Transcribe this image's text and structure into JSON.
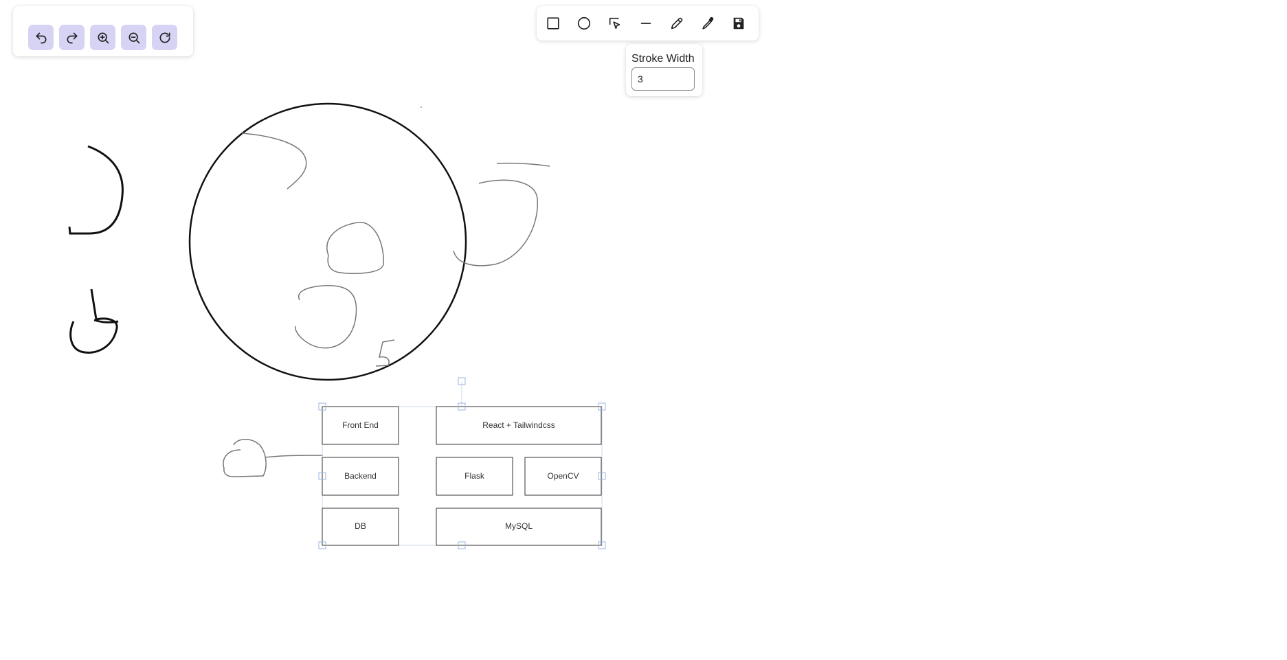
{
  "history_toolbar": {
    "buttons": [
      {
        "id": "undo",
        "icon": "undo-icon"
      },
      {
        "id": "redo",
        "icon": "redo-icon"
      },
      {
        "id": "zoom_in",
        "icon": "zoom-in-icon"
      },
      {
        "id": "zoom_out",
        "icon": "zoom-out-icon"
      },
      {
        "id": "reset",
        "icon": "reset-icon"
      }
    ]
  },
  "tools_toolbar": {
    "tools": [
      {
        "id": "rectangle",
        "icon": "rectangle-icon"
      },
      {
        "id": "circle",
        "icon": "circle-icon"
      },
      {
        "id": "select",
        "icon": "select-cursor-icon"
      },
      {
        "id": "line",
        "icon": "line-icon"
      },
      {
        "id": "pencil",
        "icon": "pencil-icon"
      },
      {
        "id": "eyedropper",
        "icon": "eyedropper-icon"
      },
      {
        "id": "save",
        "icon": "save-icon"
      }
    ]
  },
  "stroke_panel": {
    "label": "Stroke Width",
    "value": "3"
  },
  "diagram": {
    "boxes": [
      {
        "label": "Front End"
      },
      {
        "label": "React + Tailwindcss"
      },
      {
        "label": "Backend"
      },
      {
        "label": "Flask"
      },
      {
        "label": "OpenCV"
      },
      {
        "label": "DB"
      },
      {
        "label": "MySQL"
      }
    ]
  },
  "colors": {
    "button_bg": "#d6d3f5",
    "selection_handle": "#9db3e0",
    "stroke_dark": "#111111",
    "stroke_gray": "#777777"
  }
}
